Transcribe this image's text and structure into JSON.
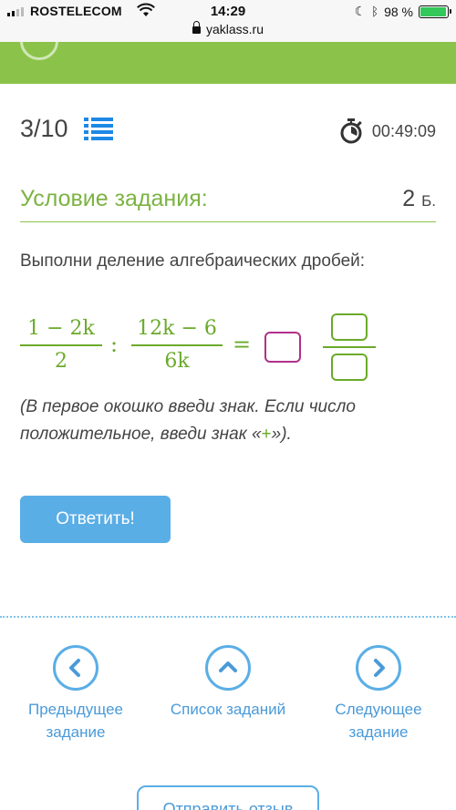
{
  "status_bar": {
    "carrier": "ROSTELECOM",
    "time": "14:29",
    "battery": "98 %",
    "battery_level": 0.98
  },
  "url_bar": {
    "domain": "yaklass.ru"
  },
  "header": {
    "counter": "3/10",
    "timer": "00:49:09"
  },
  "condition": {
    "title": "Условие задания:",
    "points_value": "2",
    "points_unit": "Б."
  },
  "task": {
    "text": "Выполни деление алгебраических дробей:",
    "fraction1_num": "1 − 2k",
    "fraction1_den": "2",
    "divide_op": ":",
    "fraction2_num": "12k − 6",
    "fraction2_den": "6k",
    "equals": "=",
    "hint_part1": "(В первое окошко введи знак. Если число положительное, введи знак «",
    "hint_plus": "+",
    "hint_part2": "»)."
  },
  "actions": {
    "answer_label": "Ответить!"
  },
  "nav": {
    "prev_label": "Предыдущее задание",
    "list_label": "Список заданий",
    "next_label": "Следующее задание"
  },
  "feedback": {
    "label": "Отправить отзыв"
  },
  "colors": {
    "accent_green": "#8bc34a",
    "accent_blue": "#5aaee6",
    "sign_box": "#b0308a"
  }
}
